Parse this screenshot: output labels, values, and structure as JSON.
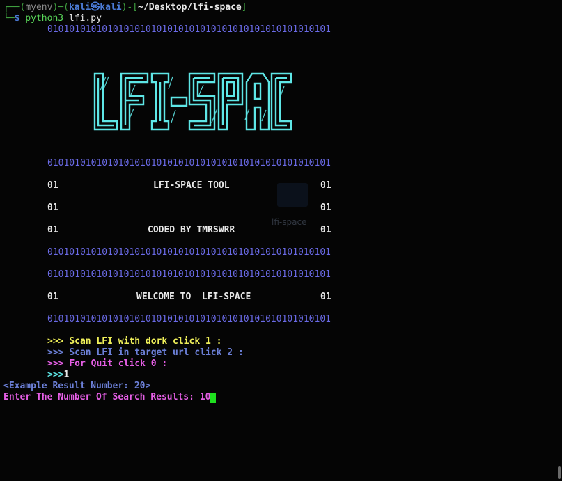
{
  "prompt": {
    "line1_prefix": "┌──(",
    "env": "myenv",
    "sep1": ")─(",
    "user_host": "kali㉿kali",
    "sep2": ")-[",
    "path": "~/Desktop/lfi-space",
    "sep3": "]",
    "line2_prefix": "└─",
    "dollar": "$ ",
    "cmd": "python3",
    "arg": " lfi.py"
  },
  "banner": {
    "binary_line": "0101010101010101010101010101010101010101010101010101",
    "logo_text": "LFI-SPACE",
    "row_edge": "01",
    "tool_title": "LFI-SPACE TOOL",
    "coded_by": "CODED BY TMRSWRR",
    "welcome": "WELCOME TO  LFI-SPACE"
  },
  "menu": {
    "arrow": ">>> ",
    "opt1": "Scan LFI with dork click 1 :",
    "opt2": "Scan LFI in target url click 2 :",
    "opt3": "For Quit click 0 :",
    "input_prompt": ">>>",
    "input_value": "1"
  },
  "output": {
    "example": "<Example Result Number: 20>",
    "ask": "Enter The Number Of Search Results: ",
    "typed": "10"
  },
  "desktop_icon": {
    "label": "lfi-space"
  },
  "colors": {
    "background": "#050505",
    "banner_cyan": "#5ee6e6",
    "binary_purple": "#6a6ae6",
    "cursor_green": "#1fe01f"
  }
}
